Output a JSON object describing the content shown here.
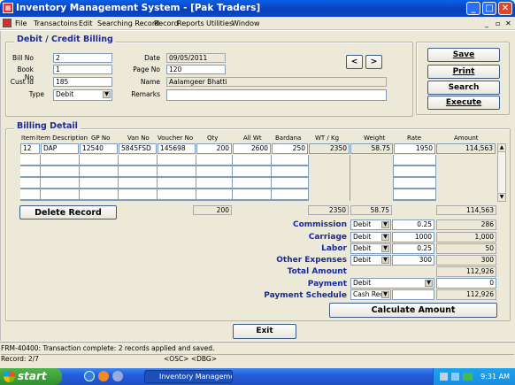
{
  "window": {
    "title": "Inventory Management System - [Pak Traders]"
  },
  "menu": [
    "File",
    "Transactoins",
    "Edit",
    "Searching Record",
    "Record",
    "Reports",
    "Utilities",
    "Window"
  ],
  "billing": {
    "legend": "Debit /  Credit Billing",
    "bill_no_label": "Bill No",
    "bill_no": "2",
    "book_no_label": "Book No",
    "book_no": "1",
    "cust_id_label": "Cust Id",
    "cust_id": "185",
    "type_label": "Type",
    "type": "Debit",
    "date_label": "Date",
    "date": "09/05/2011",
    "page_no_label": "Page No",
    "page_no": "120",
    "name_label": "Name",
    "name": "Aalamgeer Bhatti",
    "remarks_label": "Remarks",
    "remarks": "",
    "prev": "<",
    "next": ">"
  },
  "actions": {
    "save": "Save",
    "print": "Print",
    "search": "Search",
    "execute": "Execute"
  },
  "detail": {
    "legend": "Billing Detail",
    "headers": [
      "Item",
      "Item Description",
      "GP No",
      "Van No",
      "Voucher No",
      "Qty",
      "All Wt",
      "Bardana",
      "WT / Kg",
      "Weight",
      "Rate",
      "Amount"
    ],
    "row1": [
      "12",
      "DAP",
      "12540",
      "5845FSD",
      "145698",
      "200",
      "2600",
      "250",
      "2350",
      "58.75",
      "1950",
      "114,563"
    ],
    "totals": {
      "qty": "200",
      "wtkg": "2350",
      "weight": "58.75",
      "amount": "114,563"
    },
    "delete_label": "Delete Record"
  },
  "summary": {
    "commission": {
      "label": "Commission",
      "type": "Debit",
      "rate": "0.25",
      "amount": "286"
    },
    "carriage": {
      "label": "Carriage",
      "type": "Debit",
      "rate": "1000",
      "amount": "1,000"
    },
    "labor": {
      "label": "Labor",
      "type": "Debit",
      "rate": "0.25",
      "amount": "50"
    },
    "other": {
      "label": "Other Expenses",
      "type": "Debit",
      "rate": "300",
      "amount": "300"
    },
    "total": {
      "label": "Total Amount",
      "amount": "112,926"
    },
    "payment": {
      "label": "Payment",
      "type": "Debit",
      "amount": "0"
    },
    "schedule": {
      "label": "Payment Schedule",
      "type": "Cash Rec",
      "amount": "112,926"
    },
    "calculate": "Calculate Amount"
  },
  "exit_label": "Exit",
  "status": {
    "message": "FRM-40400: Transaction complete: 2 records applied and saved.",
    "record": "Record: 2/7",
    "osc": "<OSC> <DBG>"
  },
  "taskbar": {
    "start": "start",
    "app": "Inventory Manageme...",
    "clock": "9:31 AM"
  }
}
